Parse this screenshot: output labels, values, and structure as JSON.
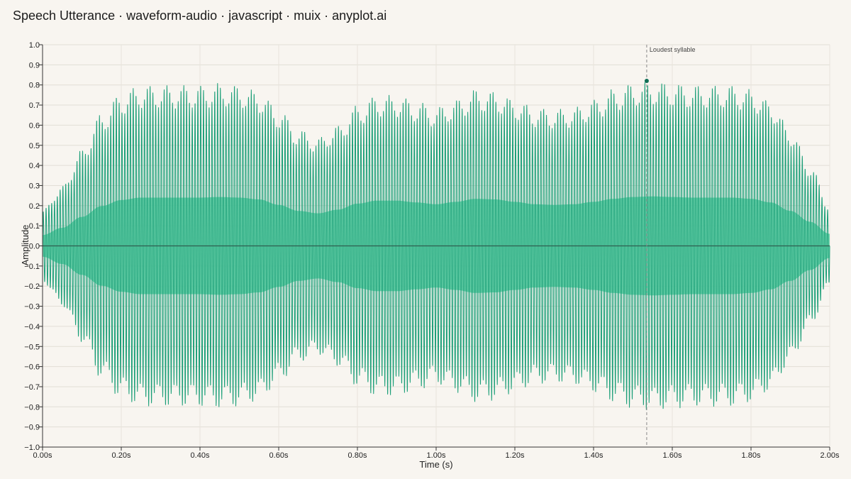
{
  "page": {
    "title": "Speech Utterance · waveform-audio · javascript · muix · anyplot.ai"
  },
  "chart_data": {
    "type": "area",
    "title": "Speech Utterance · waveform-audio · javascript · muix · anyplot.ai",
    "xlabel": "Time (s)",
    "ylabel": "Amplitude",
    "xlim": [
      0,
      2.0
    ],
    "ylim": [
      -1.0,
      1.0
    ],
    "x_ticks": [
      0,
      0.2,
      0.4,
      0.6,
      0.8,
      1.0,
      1.2,
      1.4,
      1.6,
      1.8,
      2.0
    ],
    "x_tick_labels": [
      "0.00s",
      "0.20s",
      "0.40s",
      "0.60s",
      "0.80s",
      "1.00s",
      "1.20s",
      "1.40s",
      "1.60s",
      "1.80s",
      "2.00s"
    ],
    "y_ticks": [
      -1.0,
      -0.9,
      -0.8,
      -0.7,
      -0.6,
      -0.5,
      -0.4,
      -0.3,
      -0.2,
      -0.1,
      0.0,
      0.1,
      0.2,
      0.3,
      0.4,
      0.5,
      0.6,
      0.7,
      0.8,
      0.9,
      1.0
    ],
    "y_tick_labels": [
      "−1.0",
      "−0.9",
      "−0.8",
      "−0.7",
      "−0.6",
      "−0.5",
      "−0.4",
      "−0.3",
      "−0.2",
      "−0.1",
      "0.0",
      "0.1",
      "0.2",
      "0.3",
      "0.4",
      "0.5",
      "0.6",
      "0.7",
      "0.8",
      "0.9",
      "1.0"
    ],
    "grid": true,
    "envelope": {
      "t": [
        0.0,
        0.05,
        0.1,
        0.15,
        0.2,
        0.25,
        0.3,
        0.35,
        0.4,
        0.45,
        0.5,
        0.55,
        0.6,
        0.65,
        0.7,
        0.75,
        0.8,
        0.85,
        0.9,
        0.95,
        1.0,
        1.05,
        1.1,
        1.15,
        1.2,
        1.25,
        1.3,
        1.35,
        1.4,
        1.45,
        1.5,
        1.55,
        1.6,
        1.65,
        1.7,
        1.75,
        1.8,
        1.85,
        1.9,
        1.95,
        2.0
      ],
      "amplitude": [
        0.18,
        0.3,
        0.48,
        0.66,
        0.76,
        0.8,
        0.8,
        0.8,
        0.8,
        0.81,
        0.8,
        0.77,
        0.68,
        0.58,
        0.54,
        0.6,
        0.7,
        0.75,
        0.75,
        0.72,
        0.69,
        0.73,
        0.78,
        0.77,
        0.73,
        0.69,
        0.68,
        0.69,
        0.73,
        0.78,
        0.81,
        0.82,
        0.81,
        0.8,
        0.8,
        0.8,
        0.78,
        0.72,
        0.58,
        0.4,
        0.2
      ]
    },
    "oscillation_cycles_per_second": 140,
    "series_color": "#1a9e77",
    "inner_fill_color": "#5ed3a6",
    "zero_line_color": "#2f5f50",
    "annotation": {
      "label": "Loudest syllable",
      "x": 1.535,
      "y": 0.82
    }
  }
}
